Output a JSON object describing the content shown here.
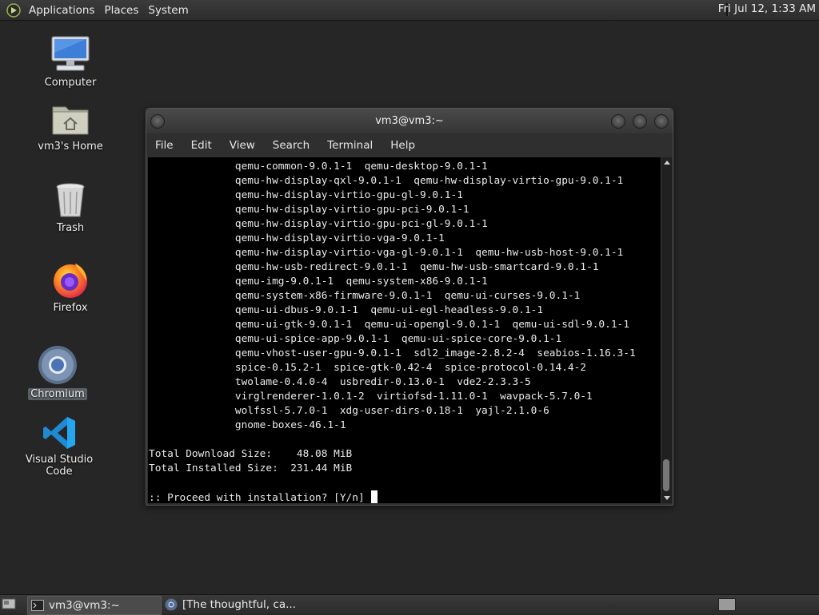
{
  "top_panel": {
    "menus": [
      "Applications",
      "Places",
      "System"
    ],
    "clock": "Fri Jul 12, 1:33 AM"
  },
  "desktop_icons": [
    {
      "label": "Computer",
      "icon": "computer-icon"
    },
    {
      "label": "vm3's Home",
      "icon": "home-folder-icon"
    },
    {
      "label": "Trash",
      "icon": "trash-icon"
    },
    {
      "label": "Firefox",
      "icon": "firefox-icon"
    },
    {
      "label": "Chromium",
      "icon": "chromium-icon",
      "selected": true
    },
    {
      "label": "Visual Studio Code",
      "icon": "vscode-icon"
    }
  ],
  "terminal": {
    "title": "vm3@vm3:~",
    "menus": [
      "File",
      "Edit",
      "View",
      "Search",
      "Terminal",
      "Help"
    ],
    "lines": [
      "              qemu-common-9.0.1-1  qemu-desktop-9.0.1-1",
      "              qemu-hw-display-qxl-9.0.1-1  qemu-hw-display-virtio-gpu-9.0.1-1",
      "              qemu-hw-display-virtio-gpu-gl-9.0.1-1",
      "              qemu-hw-display-virtio-gpu-pci-9.0.1-1",
      "              qemu-hw-display-virtio-gpu-pci-gl-9.0.1-1",
      "              qemu-hw-display-virtio-vga-9.0.1-1",
      "              qemu-hw-display-virtio-vga-gl-9.0.1-1  qemu-hw-usb-host-9.0.1-1",
      "              qemu-hw-usb-redirect-9.0.1-1  qemu-hw-usb-smartcard-9.0.1-1",
      "              qemu-img-9.0.1-1  qemu-system-x86-9.0.1-1",
      "              qemu-system-x86-firmware-9.0.1-1  qemu-ui-curses-9.0.1-1",
      "              qemu-ui-dbus-9.0.1-1  qemu-ui-egl-headless-9.0.1-1",
      "              qemu-ui-gtk-9.0.1-1  qemu-ui-opengl-9.0.1-1  qemu-ui-sdl-9.0.1-1",
      "              qemu-ui-spice-app-9.0.1-1  qemu-ui-spice-core-9.0.1-1",
      "              qemu-vhost-user-gpu-9.0.1-1  sdl2_image-2.8.2-4  seabios-1.16.3-1",
      "              spice-0.15.2-1  spice-gtk-0.42-4  spice-protocol-0.14.4-2",
      "              twolame-0.4.0-4  usbredir-0.13.0-1  vde2-2.3.3-5",
      "              virglrenderer-1.0.1-2  virtiofsd-1.11.0-1  wavpack-5.7.0-1",
      "              wolfssl-5.7.0-1  xdg-user-dirs-0.18-1  yajl-2.1.0-6",
      "              gnome-boxes-46.1-1",
      "",
      "Total Download Size:    48.08 MiB",
      "Total Installed Size:  231.44 MiB",
      ""
    ],
    "prompt": ":: Proceed with installation? [Y/n] "
  },
  "taskbar": {
    "tasks": [
      {
        "label": "vm3@vm3:~",
        "icon": "terminal-icon",
        "active": true
      },
      {
        "label": "[The thoughtful, ca...",
        "icon": "browser-icon",
        "active": false
      }
    ]
  }
}
